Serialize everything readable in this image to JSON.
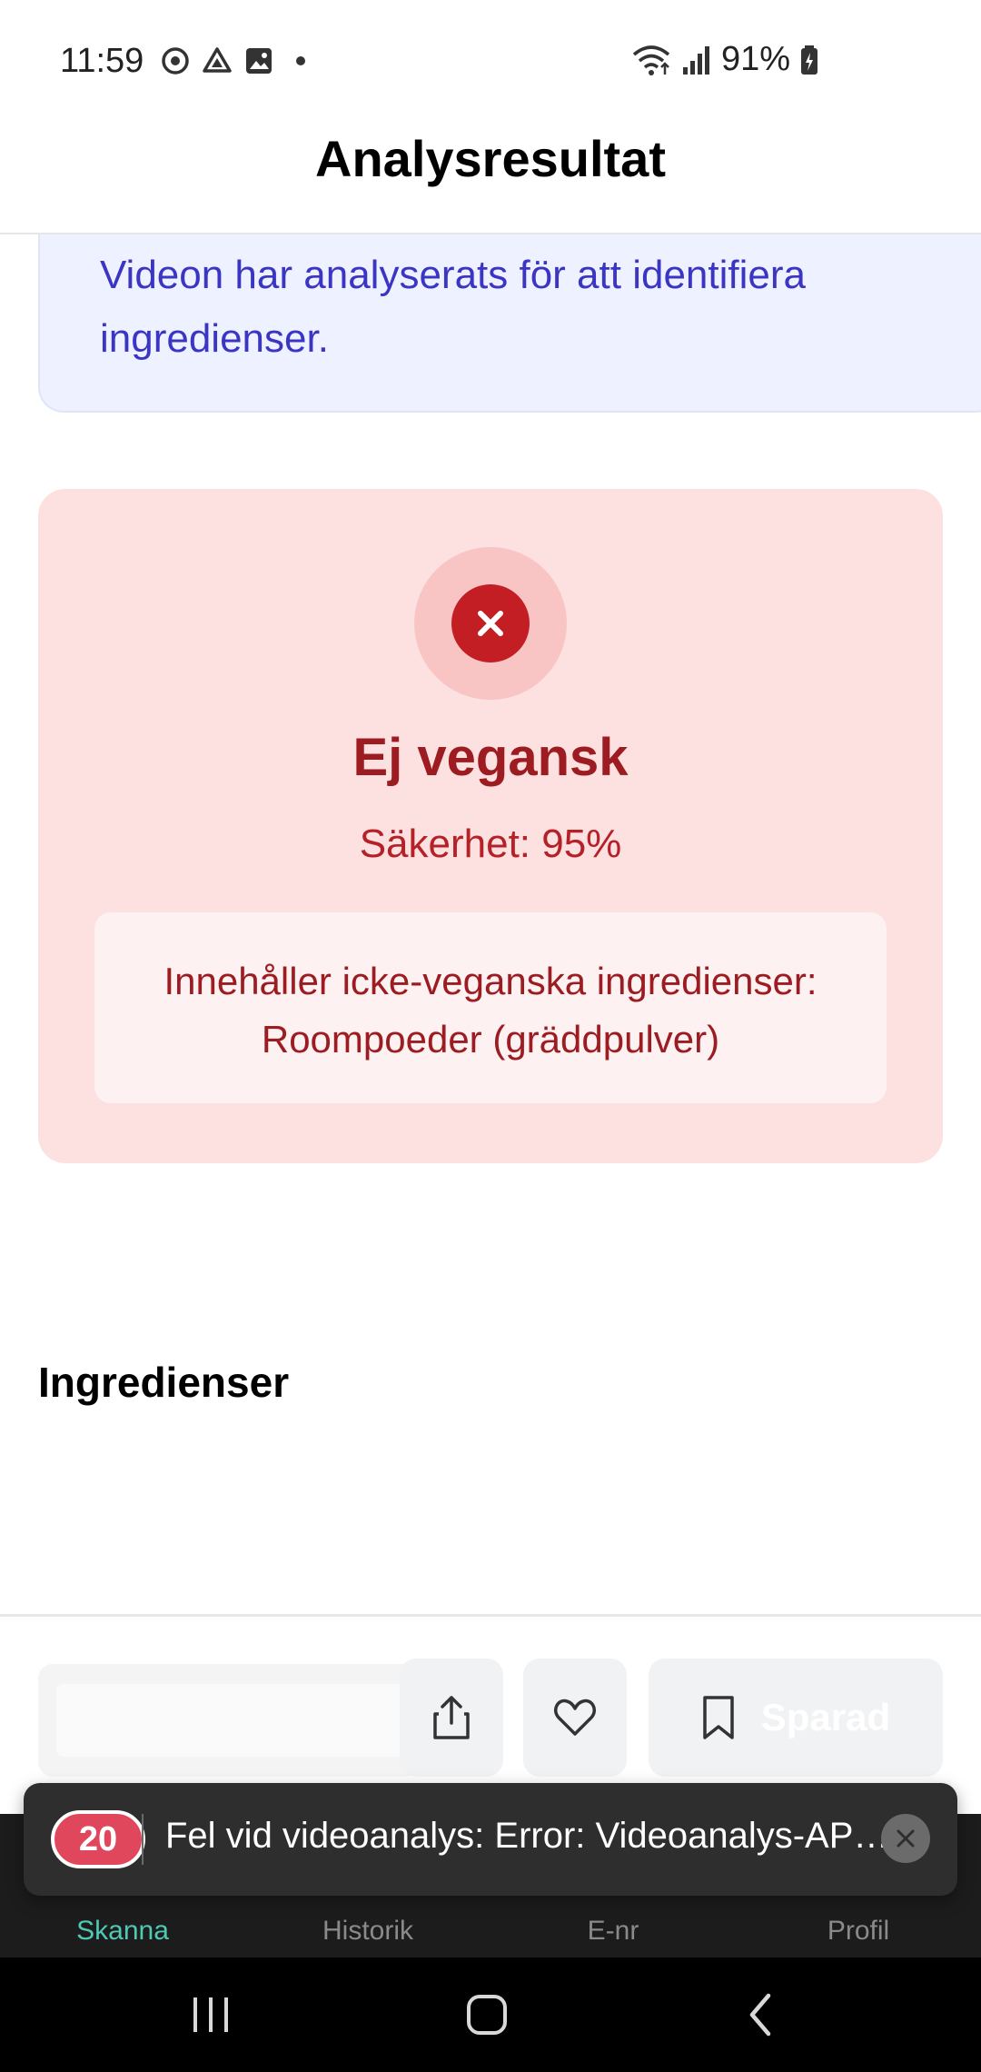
{
  "status_bar": {
    "time": "11:59",
    "battery": "91%"
  },
  "header": {
    "title": "Analysresultat"
  },
  "info": {
    "text": "Videon har analyserats för att identifiera ingredienser."
  },
  "result": {
    "title": "Ej vegansk",
    "confidence": "Säkerhet: 95%",
    "reason": "Innehåller icke-veganska ingredienser: Roompoeder (gräddpulver)",
    "status_color": "#c21e24"
  },
  "ingredients": {
    "title": "Ingredienser"
  },
  "actions": {
    "save_label": "Sparad"
  },
  "nav": {
    "items": [
      {
        "label": "Skanna",
        "active": true
      },
      {
        "label": "Historik",
        "active": false
      },
      {
        "label": "E-nr",
        "active": false
      },
      {
        "label": "Profil",
        "active": false
      }
    ],
    "active_color": "#4fc9b4"
  },
  "toast": {
    "badge": "20",
    "message": "Fel vid videoanalys: Error: Videoanalys-API-fel"
  }
}
